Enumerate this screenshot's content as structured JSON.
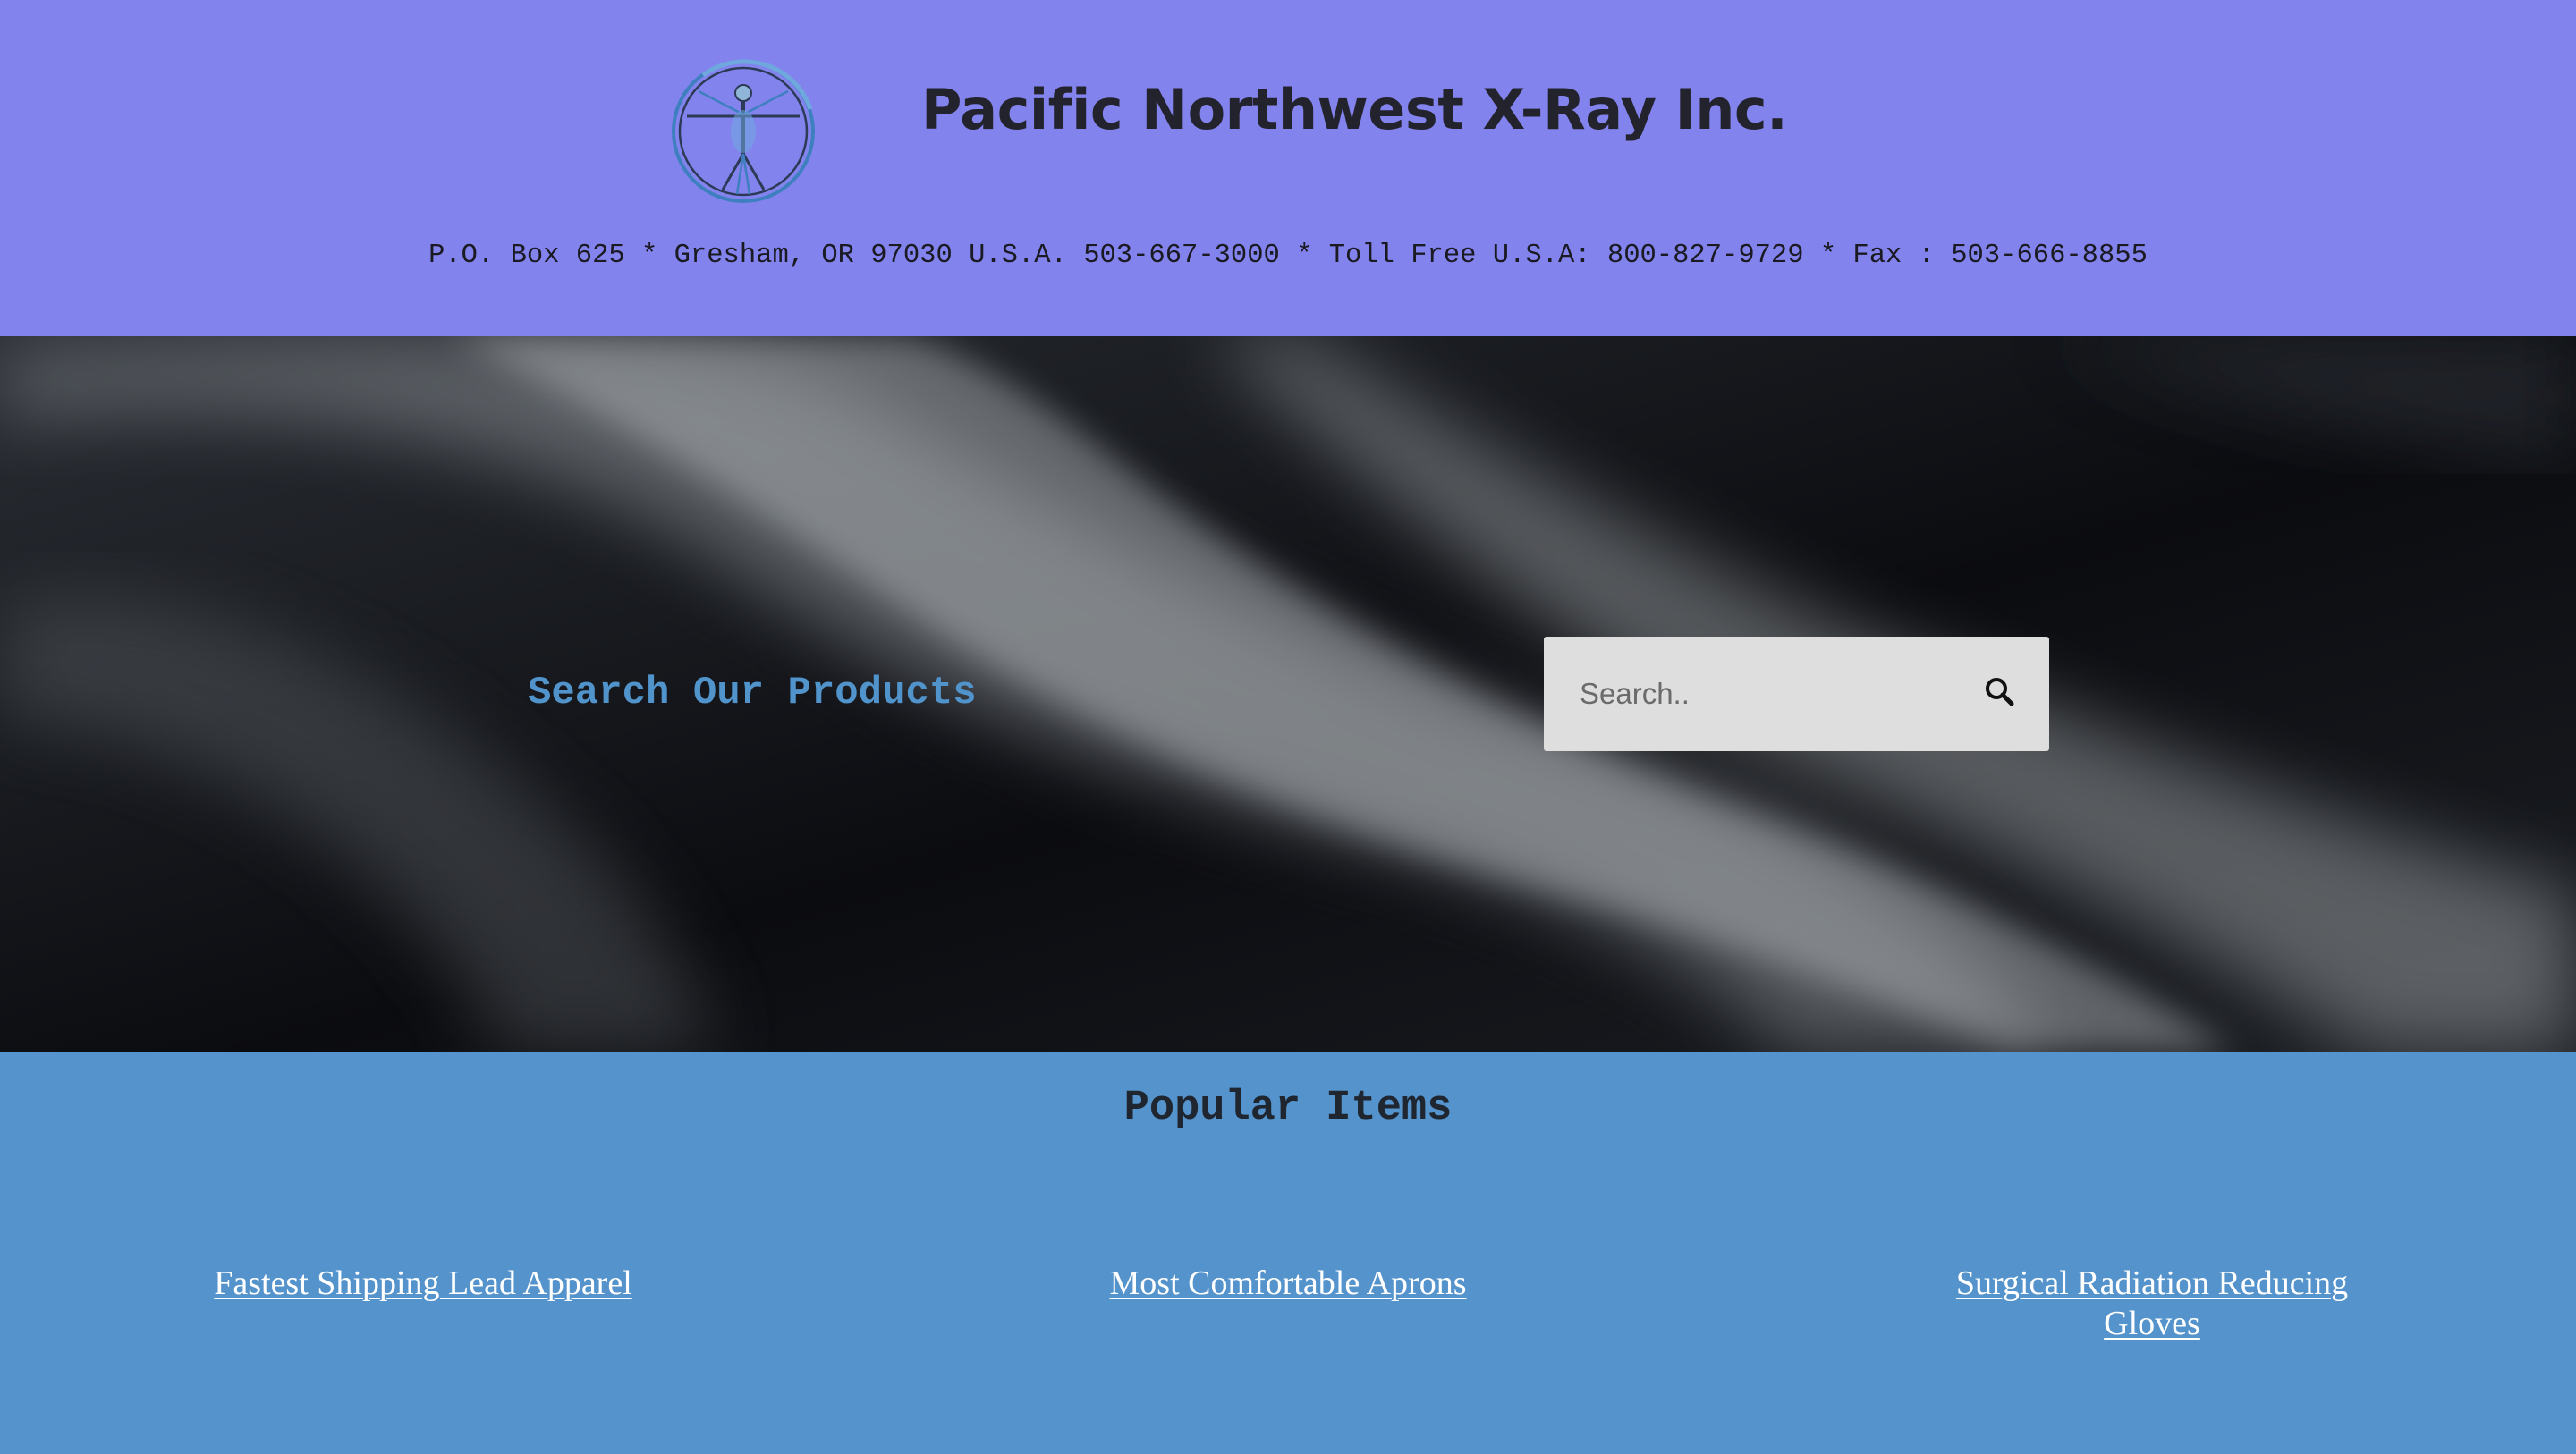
{
  "header": {
    "company_name": "Pacific Northwest X-Ray Inc.",
    "contact_line": "P.O. Box 625 * Gresham, OR 97030 U.S.A. 503-667-3000 * Toll Free U.S.A: 800-827-9729 * Fax : 503-666-8855",
    "logo_icon": "vitruvian-man-logo"
  },
  "search": {
    "heading": "Search Our Products",
    "placeholder": "Search..",
    "icon": "search-icon"
  },
  "popular": {
    "heading": "Popular Items",
    "items": [
      {
        "label": "Fastest Shipping Lead Apparel"
      },
      {
        "label": "Most Comfortable Aprons"
      },
      {
        "label": "Surgical Radiation Reducing Gloves"
      }
    ]
  },
  "colors": {
    "header_bg": "#8383ee",
    "popular_bg": "#5493cb",
    "accent_text": "#5193cb",
    "search_box_bg": "#dedede"
  }
}
